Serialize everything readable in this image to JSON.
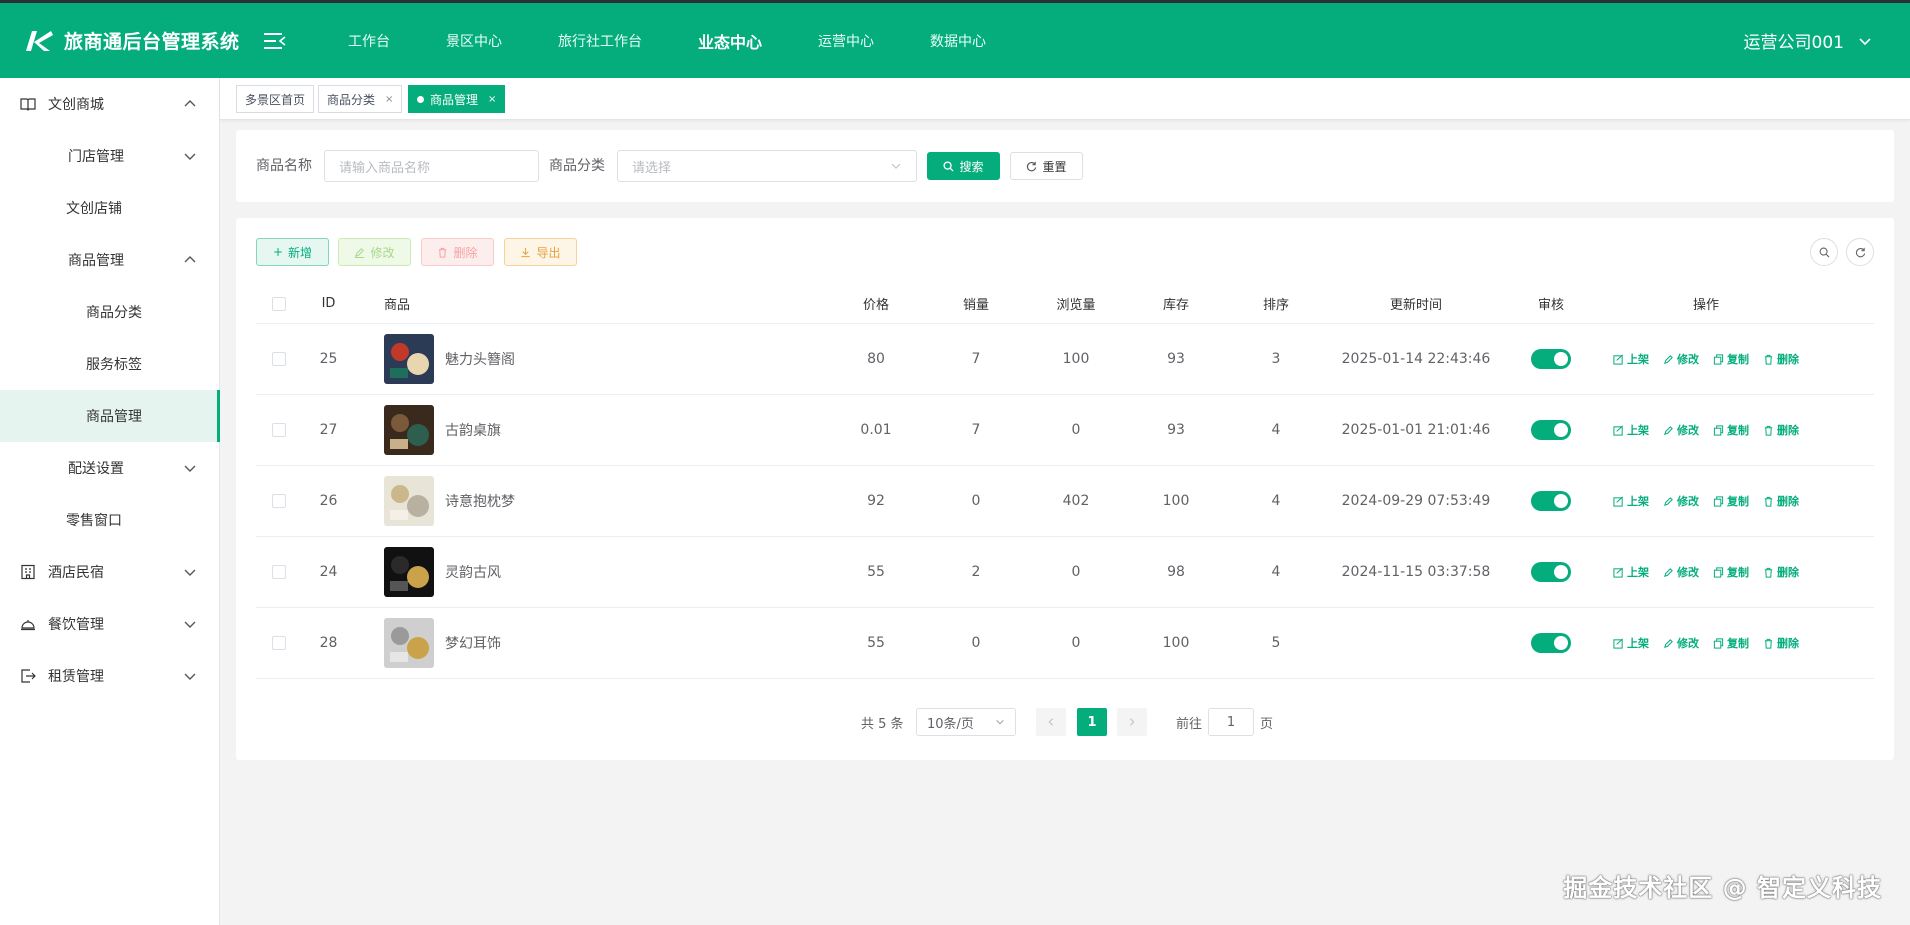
{
  "header": {
    "logo_text": "旅商通后台管理系统",
    "nav": [
      "工作台",
      "景区中心",
      "旅行社工作台",
      "业态中心",
      "运营中心",
      "数据中心"
    ],
    "active_nav": "业态中心",
    "user": "运营公司001"
  },
  "sidebar": {
    "group_wenchuang": "文创商城",
    "item_mendian": "门店管理",
    "item_dianpu": "文创店铺",
    "item_shangpin": "商品管理",
    "sub_fenlei": "商品分类",
    "sub_biaoqian": "服务标签",
    "sub_guanli": "商品管理",
    "item_peisong": "配送设置",
    "item_lingshou": "零售窗口",
    "group_jiudian": "酒店民宿",
    "group_canyin": "餐饮管理",
    "group_zulin": "租赁管理"
  },
  "tabs": {
    "home": "多景区首页",
    "category": "商品分类",
    "current": "商品管理",
    "close": "×"
  },
  "search": {
    "name_label": "商品名称",
    "name_placeholder": "请输入商品名称",
    "category_label": "商品分类",
    "category_placeholder": "请选择",
    "search_btn": "搜索",
    "reset_btn": "重置"
  },
  "toolbar": {
    "add": "新增",
    "edit": "修改",
    "delete": "删除",
    "export": "导出"
  },
  "table": {
    "headers": {
      "id": "ID",
      "product": "商品",
      "price": "价格",
      "sales": "销量",
      "views": "浏览量",
      "stock": "库存",
      "sort": "排序",
      "updated": "更新时间",
      "audit": "审核",
      "actions": "操作"
    },
    "action_labels": {
      "shelf": "上架",
      "edit": "修改",
      "copy": "复制",
      "delete": "删除"
    },
    "rows": [
      {
        "id": "25",
        "name": "魅力头簪阁",
        "price": "80",
        "sales": "7",
        "views": "100",
        "stock": "93",
        "sort": "3",
        "updated": "2025-01-14 22:43:46",
        "audit_on": true
      },
      {
        "id": "27",
        "name": "古韵桌旗",
        "price": "0.01",
        "sales": "7",
        "views": "0",
        "stock": "93",
        "sort": "4",
        "updated": "2025-01-01 21:01:46",
        "audit_on": true
      },
      {
        "id": "26",
        "name": "诗意抱枕梦",
        "price": "92",
        "sales": "0",
        "views": "402",
        "stock": "100",
        "sort": "4",
        "updated": "2024-09-29 07:53:49",
        "audit_on": true
      },
      {
        "id": "24",
        "name": "灵韵古风",
        "price": "55",
        "sales": "2",
        "views": "0",
        "stock": "98",
        "sort": "4",
        "updated": "2024-11-15 03:37:58",
        "audit_on": true
      },
      {
        "id": "28",
        "name": "梦幻耳饰",
        "price": "55",
        "sales": "0",
        "views": "0",
        "stock": "100",
        "sort": "5",
        "updated": "",
        "audit_on": true
      }
    ]
  },
  "pagination": {
    "total": "共 5 条",
    "page_size": "10条/页",
    "current_page": "1",
    "goto_label": "前往",
    "goto_value": "1",
    "page_suffix": "页"
  },
  "watermark": "掘金技术社区 @ 智定义科技",
  "colors": {
    "primary": "#05ad7d",
    "edit": "#a8d98a",
    "danger": "#f5a3a3",
    "warning": "#e6a23c"
  }
}
